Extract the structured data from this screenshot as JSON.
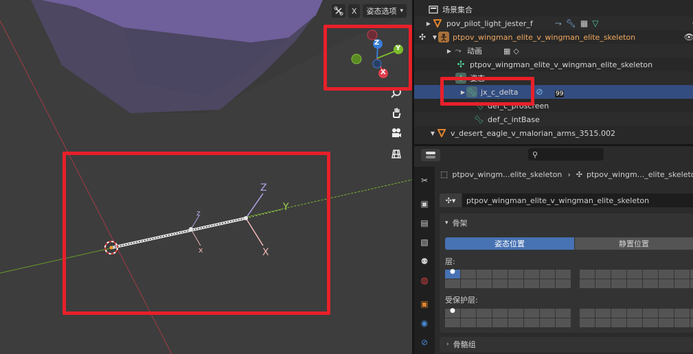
{
  "viewport": {
    "header": {
      "select_icon": "bone-select-icon",
      "x_label": "X",
      "pose_options": "姿态选项"
    },
    "nav_icons": [
      "zoom-icon",
      "hand-icon",
      "camera-icon",
      "grid-icon"
    ],
    "gizmo": {
      "z": "Z",
      "y": "Y",
      "x": "X"
    },
    "bones": {
      "big_z": "Z",
      "big_x": "X",
      "small_z": "z",
      "small_x": "x",
      "y_label": "Y"
    }
  },
  "outliner": {
    "rows": [
      {
        "label": "场景集合"
      },
      {
        "label": "pov_pilot_light_jester_f"
      },
      {
        "label": "ptpov_wingman_elite_v_wingman_elite_skeleton"
      },
      {
        "label": "动画"
      },
      {
        "label": "ptpov_wingman_elite_v_wingman_elite_skeleton"
      },
      {
        "label": "姿态"
      },
      {
        "label": "jx_c_delta"
      },
      {
        "label": "def_c_proscreen"
      },
      {
        "label": "def_c_intBase"
      },
      {
        "label": "v_desert_eagle_v_malorian_arms_3515.002"
      }
    ],
    "badge": "99"
  },
  "properties": {
    "search_placeholder": "",
    "breadcrumb": {
      "object": "ptpov_wingm...elite_skeleton",
      "data": "ptpov_wingm..._elite_skeleto"
    },
    "data_name": "ptpov_wingman_elite_v_wingman_elite_skeleton",
    "skeleton_panel": "骨架",
    "pose_position": "姿态位置",
    "rest_position": "静置位置",
    "layers_label": "层:",
    "protected_layers_label": "受保护层:",
    "bone_groups": "骨骼组"
  },
  "colors": {
    "selection": "#334d80",
    "accent": "#4772b3",
    "highlight_box": "#e8202a"
  }
}
